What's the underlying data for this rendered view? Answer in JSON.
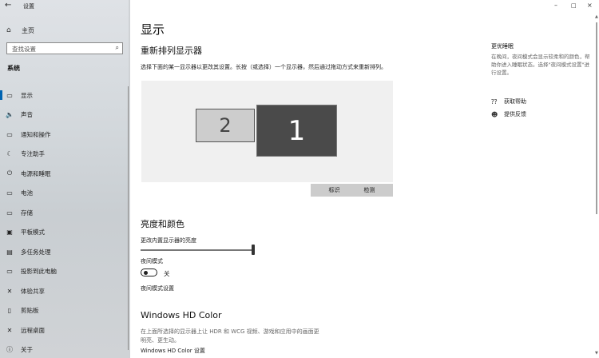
{
  "window": {
    "title": "设置",
    "minimize": "–",
    "maximize": "□",
    "close": "×",
    "back": "←"
  },
  "sidebar": {
    "home": "主页",
    "search_placeholder": "查找设置",
    "section": "系统",
    "items": [
      {
        "label": "显示",
        "icon": "monitor-icon",
        "glyph": "▭"
      },
      {
        "label": "声音",
        "icon": "speaker-icon",
        "glyph": "🔈"
      },
      {
        "label": "通知和操作",
        "icon": "notification-icon",
        "glyph": "▭"
      },
      {
        "label": "专注助手",
        "icon": "moon-icon",
        "glyph": "☾"
      },
      {
        "label": "电源和睡眠",
        "icon": "power-icon",
        "glyph": "⏻"
      },
      {
        "label": "电池",
        "icon": "battery-icon",
        "glyph": "▭"
      },
      {
        "label": "存储",
        "icon": "storage-icon",
        "glyph": "▭"
      },
      {
        "label": "平板模式",
        "icon": "tablet-icon",
        "glyph": "▣"
      },
      {
        "label": "多任务处理",
        "icon": "multitask-icon",
        "glyph": "▤"
      },
      {
        "label": "投影到此电脑",
        "icon": "project-icon",
        "glyph": "▭"
      },
      {
        "label": "体验共享",
        "icon": "share-icon",
        "glyph": "✕"
      },
      {
        "label": "剪贴板",
        "icon": "clipboard-icon",
        "glyph": "▯"
      },
      {
        "label": "远程桌面",
        "icon": "remote-desktop-icon",
        "glyph": "✕"
      },
      {
        "label": "关于",
        "icon": "info-icon",
        "glyph": "ⓘ"
      }
    ]
  },
  "main": {
    "title": "显示",
    "rearrange_heading": "重新排列显示器",
    "rearrange_desc": "选择下面的某一显示器以更改其设置。长按（或选择）一个显示器，然后通过拖动方式来重新排列。",
    "monitor_1": "1",
    "monitor_2": "2",
    "identify_button": "标识",
    "detect_button": "检测",
    "brightness_heading": "亮度和颜色",
    "brightness_label": "更改内置显示器的亮度",
    "brightness_value": 1.0,
    "night_light_label": "夜间模式",
    "night_light_state": "关",
    "night_light_settings": "夜间模式设置",
    "hdr_heading": "Windows HD Color",
    "hdr_desc_line1": "在上面所选择的显示器上让 HDR 和 WCG 视频、游戏和应用中的画面更",
    "hdr_desc_line2": "明亮、更生动。",
    "hdr_settings": "Windows HD Color 设置"
  },
  "aside": {
    "title": "更优睡眠",
    "desc": "在晚间，夜间模式会显示较柔和的颜色，帮助你进入睡眠状态。选择\"夜间模式设置\"进行设置。",
    "help": "获取帮助",
    "feedback": "提供反馈"
  }
}
